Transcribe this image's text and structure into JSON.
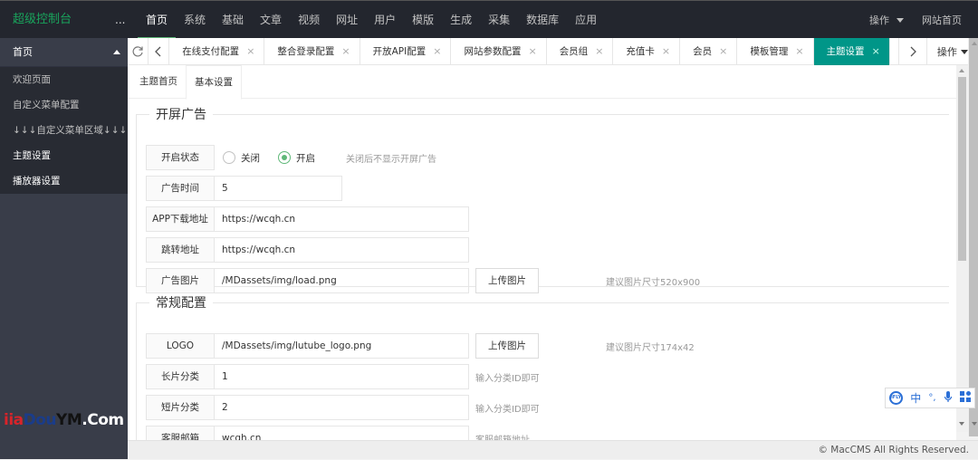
{
  "app": {
    "title": "超级控制台",
    "more": "..."
  },
  "topnav": {
    "items": [
      "首页",
      "系统",
      "基础",
      "文章",
      "视频",
      "网址",
      "用户",
      "模版",
      "生成",
      "采集",
      "数据库",
      "应用"
    ],
    "active": "首页",
    "operate_label": "操作",
    "site_home_label": "网站首页"
  },
  "sidebar": {
    "header": "首页",
    "items": [
      "欢迎页面",
      "自定义菜单配置",
      "↓↓↓自定义菜单区域↓↓↓",
      "主题设置",
      "播放器设置"
    ]
  },
  "watermark": {
    "part1": "i",
    "part2": "ia",
    "part3": "Dou",
    "part4": "YM",
    "part5": ".Com"
  },
  "tabbar": {
    "tabs": [
      "在线支付配置",
      "整合登录配置",
      "开放API配置",
      "网站参数配置",
      "会员组",
      "充值卡",
      "会员",
      "模板管理",
      "主题设置"
    ],
    "active": "主题设置",
    "close_glyph": "×",
    "operate_label": "操作"
  },
  "subtabs": {
    "items": [
      "主题首页",
      "基本设置"
    ],
    "active": "基本设置"
  },
  "splash_ad": {
    "legend": "开屏广告",
    "status": {
      "label": "开启状态",
      "options": [
        "关闭",
        "开启"
      ],
      "selected": "开启",
      "hint": "关闭后不显示开屏广告"
    },
    "duration": {
      "label": "广告时间",
      "value": "5"
    },
    "app_url": {
      "label": "APP下载地址",
      "value": "https://wcqh.cn"
    },
    "jump_url": {
      "label": "跳转地址",
      "value": "https://wcqh.cn"
    },
    "image": {
      "label": "广告图片",
      "value": "/MDassets/img/load.png",
      "upload_label": "上传图片",
      "hint": "建议图片尺寸520x900"
    }
  },
  "general": {
    "legend": "常规配置",
    "logo": {
      "label": "LOGO",
      "value": "/MDassets/img/lutube_logo.png",
      "upload_label": "上传图片",
      "hint": "建议图片尺寸174x42"
    },
    "long_cat": {
      "label": "长片分类",
      "value": "1",
      "hint": "输入分类ID即可"
    },
    "short_cat": {
      "label": "短片分类",
      "value": "2",
      "hint": "输入分类ID即可"
    },
    "email": {
      "label": "客服邮箱",
      "value": "wcqh.cn",
      "hint": "客服邮箱地址"
    }
  },
  "footer": {
    "text": "© MacCMS All Rights Reserved."
  },
  "ime": {
    "mode": "中",
    "punct": "°,",
    "logo": "iFLY"
  },
  "colors": {
    "accent": "#009688",
    "brand_green": "#19a45c",
    "topbar": "#23262e",
    "sidebar": "#393d49",
    "radio_on": "#5fb878"
  }
}
